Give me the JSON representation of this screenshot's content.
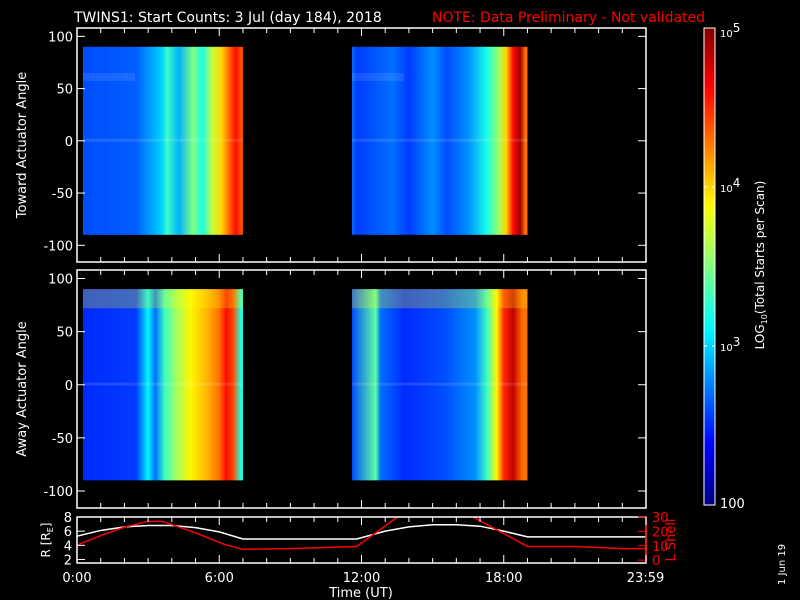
{
  "title": {
    "main": "TWINS1: Start Counts:  3 Jul (day 184), 2018",
    "note": "NOTE: Data Preliminary - Not validated"
  },
  "colors": {
    "note": "#ff0000",
    "axis": "#ffffff",
    "lshell": "#ff0000"
  },
  "footer_date": "1 Jun 19",
  "chart_data": [
    {
      "type": "heatmap",
      "ylabel": "Toward Actuator Angle",
      "ylim": [
        -116,
        108
      ],
      "yticks": [
        "100",
        "50",
        "0",
        "-50",
        "-100"
      ],
      "ytick_values": [
        100,
        50,
        0,
        -50,
        -100
      ],
      "xlim_hours": [
        0,
        24
      ],
      "blocks": [
        {
          "t0": 0.25,
          "t1": 7.0,
          "a0": -90,
          "a1": 90,
          "columns": [
            [
              0.25,
              2.6
            ],
            [
              2.5,
              2.65
            ],
            [
              3.6,
              3.0
            ],
            [
              3.8,
              3.3
            ],
            [
              4.3,
              2.9
            ],
            [
              4.9,
              3.5
            ],
            [
              5.3,
              3.2
            ],
            [
              5.7,
              3.7
            ],
            [
              6.1,
              4.0
            ],
            [
              6.4,
              4.3
            ],
            [
              6.7,
              4.6
            ],
            [
              6.9,
              4.4
            ]
          ]
        },
        {
          "t0": 11.6,
          "t1": 19.0,
          "a0": -90,
          "a1": 90,
          "columns": [
            [
              11.6,
              2.7
            ],
            [
              11.8,
              2.55
            ],
            [
              13.3,
              2.7
            ],
            [
              14.0,
              2.55
            ],
            [
              15.0,
              2.8
            ],
            [
              15.6,
              2.6
            ],
            [
              16.5,
              2.8
            ],
            [
              17.3,
              3.2
            ],
            [
              17.8,
              3.6
            ],
            [
              18.1,
              4.0
            ],
            [
              18.4,
              4.6
            ],
            [
              18.7,
              4.9
            ],
            [
              18.9,
              4.3
            ]
          ]
        }
      ]
    },
    {
      "type": "heatmap",
      "ylabel": "Away Actuator Angle",
      "ylim": [
        -116,
        108
      ],
      "yticks": [
        "100",
        "50",
        "0",
        "-50",
        "-100"
      ],
      "ytick_values": [
        100,
        50,
        0,
        -50,
        -100
      ],
      "xlim_hours": [
        0,
        24
      ],
      "blocks": [
        {
          "t0": 0.25,
          "t1": 7.0,
          "a0": -90,
          "a1": 90,
          "columns": [
            [
              0.25,
              2.5
            ],
            [
              2.5,
              2.55
            ],
            [
              3.0,
              3.1
            ],
            [
              3.3,
              2.7
            ],
            [
              3.7,
              3.3
            ],
            [
              4.2,
              3.6
            ],
            [
              4.8,
              3.9
            ],
            [
              5.5,
              4.1
            ],
            [
              6.0,
              4.3
            ],
            [
              6.3,
              4.6
            ],
            [
              6.6,
              4.4
            ],
            [
              6.9,
              3.2
            ]
          ]
        },
        {
          "t0": 11.6,
          "t1": 19.0,
          "a0": -90,
          "a1": 90,
          "columns": [
            [
              11.6,
              2.6
            ],
            [
              12.6,
              3.4
            ],
            [
              12.8,
              2.7
            ],
            [
              13.8,
              2.5
            ],
            [
              15.5,
              2.6
            ],
            [
              16.8,
              2.8
            ],
            [
              17.3,
              3.3
            ],
            [
              17.7,
              3.9
            ],
            [
              18.0,
              4.5
            ],
            [
              18.4,
              4.8
            ],
            [
              18.8,
              4.3
            ]
          ]
        }
      ]
    },
    {
      "type": "line",
      "xlabel": "Time (UT)",
      "xticks": [
        "0:00",
        "6:00",
        "12:00",
        "18:00",
        "23:59"
      ],
      "xtick_hours": [
        0,
        6,
        12,
        18,
        23.98
      ],
      "ylabel": "R [R",
      "ylabel_sub": "E",
      "ylabel_close": "]",
      "ylim": [
        1.5,
        8
      ],
      "yticks": [
        "2",
        "4",
        "6",
        "8"
      ],
      "ytick_values": [
        2,
        4,
        6,
        8
      ],
      "y2label": "L Shell",
      "y2lim": [
        -2,
        30
      ],
      "y2ticks": [
        "0",
        "10",
        "20",
        "30"
      ],
      "y2tick_values": [
        0,
        10,
        20,
        30
      ],
      "series": [
        {
          "name": "R",
          "axis": "left",
          "x": [
            0,
            1,
            2,
            3,
            4,
            5,
            6,
            7,
            8,
            10,
            11.8,
            13,
            14,
            15,
            16,
            17,
            18,
            19,
            20,
            22,
            24
          ],
          "y": [
            5.3,
            6.1,
            6.6,
            6.8,
            6.8,
            6.5,
            5.9,
            4.9,
            4.9,
            4.9,
            4.9,
            6.0,
            6.6,
            6.9,
            6.9,
            6.7,
            6.0,
            5.2,
            5.2,
            5.2,
            5.2
          ]
        },
        {
          "name": "L Shell",
          "axis": "right",
          "x": [
            0,
            1,
            2,
            3,
            3.6,
            5,
            6.2,
            7,
            9,
            11.8,
            13.6,
            16.6,
            19,
            21,
            23,
            24
          ],
          "y": [
            10.5,
            17,
            23,
            27,
            27,
            19,
            11,
            7.5,
            8,
            9.5,
            31,
            31,
            9.5,
            9.5,
            8,
            8
          ]
        }
      ]
    },
    {
      "type": "colorbar",
      "label": "LOG",
      "label_sub": "10",
      "label_rest": "(Total Starts per Scan)",
      "ticks": [
        {
          "base": "10",
          "exp": "5",
          "v": 5
        },
        {
          "base": "10",
          "exp": "4",
          "v": 4
        },
        {
          "base": "10",
          "exp": "3",
          "v": 3
        },
        {
          "base": "100",
          "exp": "",
          "v": 2
        }
      ],
      "range": [
        2,
        5
      ]
    }
  ]
}
